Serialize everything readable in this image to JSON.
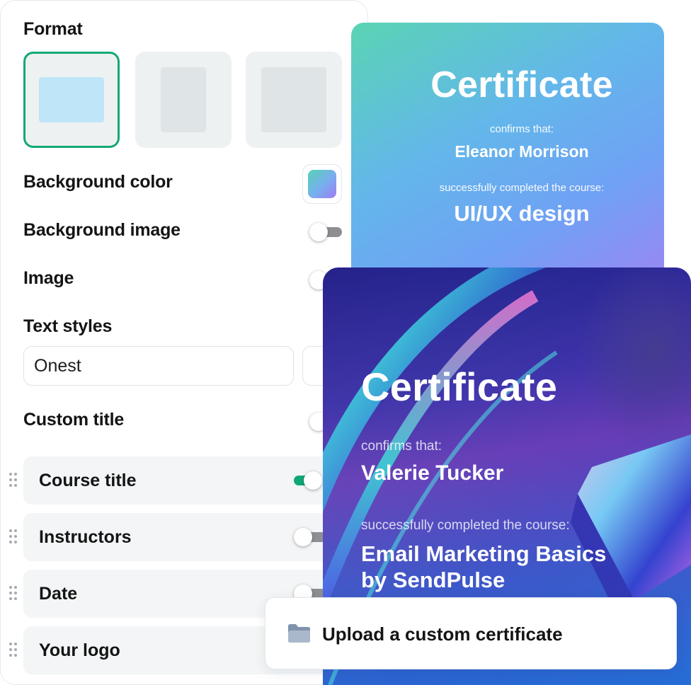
{
  "settings": {
    "format_title": "Format",
    "formats": [
      "landscape",
      "portrait",
      "square"
    ],
    "selected_format": "landscape",
    "background_color_label": "Background color",
    "background_image_label": "Background image",
    "background_image_enabled": false,
    "image_label": "Image",
    "image_enabled": false,
    "text_styles_label": "Text styles",
    "font_value": "Onest",
    "custom_title_label": "Custom title",
    "custom_title_enabled": false,
    "fields": [
      {
        "label": "Course title",
        "enabled": true
      },
      {
        "label": "Instructors",
        "enabled": false
      },
      {
        "label": "Date",
        "enabled": false
      },
      {
        "label": "Your logo",
        "enabled": false
      }
    ]
  },
  "certificate_preview_1": {
    "title": "Certificate",
    "confirms": "confirms that:",
    "name": "Eleanor Morrison",
    "completed": "successfully completed the course:",
    "course": "UI/UX design"
  },
  "certificate_preview_2": {
    "title": "Certificate",
    "confirms": "confirms that:",
    "name": "Valerie Tucker",
    "completed": "successfully completed the course:",
    "course_line1": "Email Marketing Basics",
    "course_line2": "by SendPulse"
  },
  "upload": {
    "label": "Upload a custom certificate",
    "icon": "folder-icon"
  },
  "colors": {
    "accent": "#10a774",
    "gradient_start": "#5ad4b3",
    "gradient_end": "#9a86f3"
  }
}
